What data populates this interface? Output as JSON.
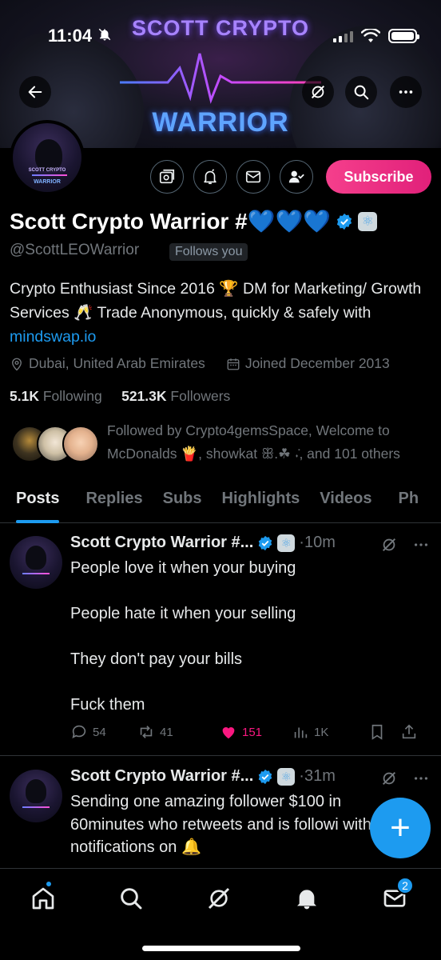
{
  "status": {
    "time": "11:04"
  },
  "banner": {
    "line1": "SCOTT CRYPTO",
    "line2": "WARRIOR"
  },
  "header_icons": [
    "back-arrow-icon",
    "grok-icon",
    "search-icon",
    "more-icon"
  ],
  "avatar_text": {
    "line1": "SCOTT CRYPTO",
    "line2": "WARRIOR"
  },
  "actions": {
    "icons": [
      "grok-analysis-icon",
      "notification-bell-icon",
      "mail-icon",
      "following-icon"
    ],
    "subscribe_label": "Subscribe"
  },
  "profile": {
    "name": "Scott Crypto Warrior #💙💙💙",
    "handle": "@ScottLEOWarrior",
    "follows_you": "Follows you",
    "bio_text": "Crypto Enthusiast Since 2016 🏆 DM for Marketing/ Growth Services 🥂 Trade Anonymous, quickly & safely with ",
    "bio_link": "mindswap.io",
    "location": "Dubai, United Arab Emirates",
    "joined": "Joined December 2013",
    "following_count": "5.1K",
    "following_label": "Following",
    "followers_count": "521.3K",
    "followers_label": "Followers",
    "followed_by": "Followed by Crypto4gemsSpace, Welcome to McDonalds 🍟, showkat ꕥ.☘︎ ݁˖, and 101 others"
  },
  "tabs": [
    "Posts",
    "Replies",
    "Subs",
    "Highlights",
    "Videos",
    "Ph"
  ],
  "posts": [
    {
      "name": "Scott Crypto Warrior #...",
      "time": "·10m",
      "text": "People love it when your buying\n\nPeople hate it when your selling\n\nThey don't pay your bills\n\nFuck them",
      "replies": "54",
      "reposts": "41",
      "likes": "151",
      "views": "1K"
    },
    {
      "name": "Scott Crypto Warrior #...",
      "time": "·31m",
      "text": "Sending one amazing follower $100 in 60minutes who retweets and is followi with notifications on 🔔"
    }
  ],
  "fab_label": "+",
  "nav": {
    "messages_badge": "2"
  },
  "colors": {
    "accent": "#1d9bf0",
    "subscribe": "#e91e7a",
    "like": "#f91880"
  }
}
